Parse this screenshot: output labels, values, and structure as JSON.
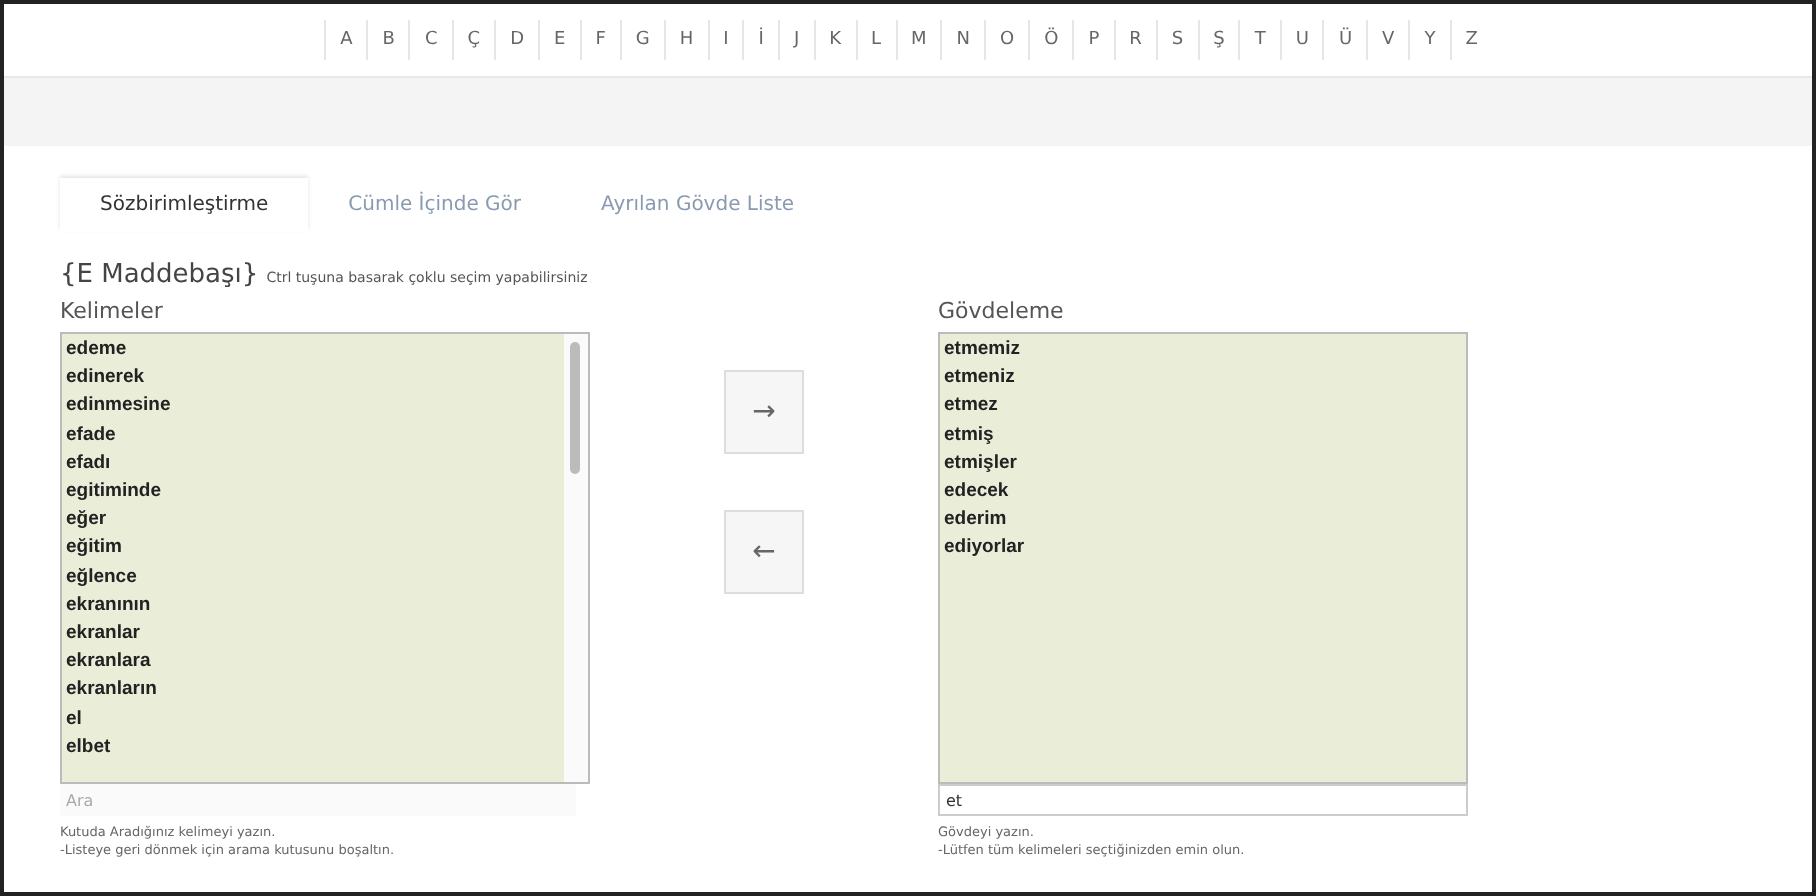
{
  "alphabet": [
    "A",
    "B",
    "C",
    "Ç",
    "D",
    "E",
    "F",
    "G",
    "H",
    "I",
    "İ",
    "J",
    "K",
    "L",
    "M",
    "N",
    "O",
    "Ö",
    "P",
    "R",
    "S",
    "Ş",
    "T",
    "U",
    "Ü",
    "V",
    "Y",
    "Z"
  ],
  "tabs": [
    {
      "label": "Sözbirimleştirme",
      "selected": true
    },
    {
      "label": "Cümle İçinde Gör",
      "selected": false
    },
    {
      "label": "Ayrılan Gövde Liste",
      "selected": false
    }
  ],
  "heading": {
    "title": "{E Maddebaşı}",
    "note": "Ctrl tuşuna basarak çoklu seçim yapabilirsiniz"
  },
  "words": {
    "label": "Kelimeler",
    "items": [
      "edeme",
      "edinerek",
      "edinmesine",
      "efade",
      "efadı",
      "egitiminde",
      "eğer",
      "eğitim",
      "eğlence",
      "ekranının",
      "ekranlar",
      "ekranlara",
      "ekranların",
      "el",
      "elbet"
    ],
    "search": {
      "placeholder": "Ara"
    },
    "hints": [
      "Kutuda Aradığınız kelimeyi yazın.",
      "-Listeye geri dönmek için arama kutusunu boşaltın."
    ]
  },
  "buttons": [
    "→",
    "←"
  ],
  "stems": {
    "label": "Gövdeleme",
    "items": [
      "etmemiz",
      "etmeniz",
      "etmez",
      "etmiş",
      "etmişler",
      "edecek",
      "ederim",
      "ediyorlar"
    ],
    "search": {
      "value": "et"
    },
    "hints": [
      "Gövdeyi yazın.",
      "-Lütfen tüm kelimeleri seçtiğinizden emin olun."
    ]
  }
}
